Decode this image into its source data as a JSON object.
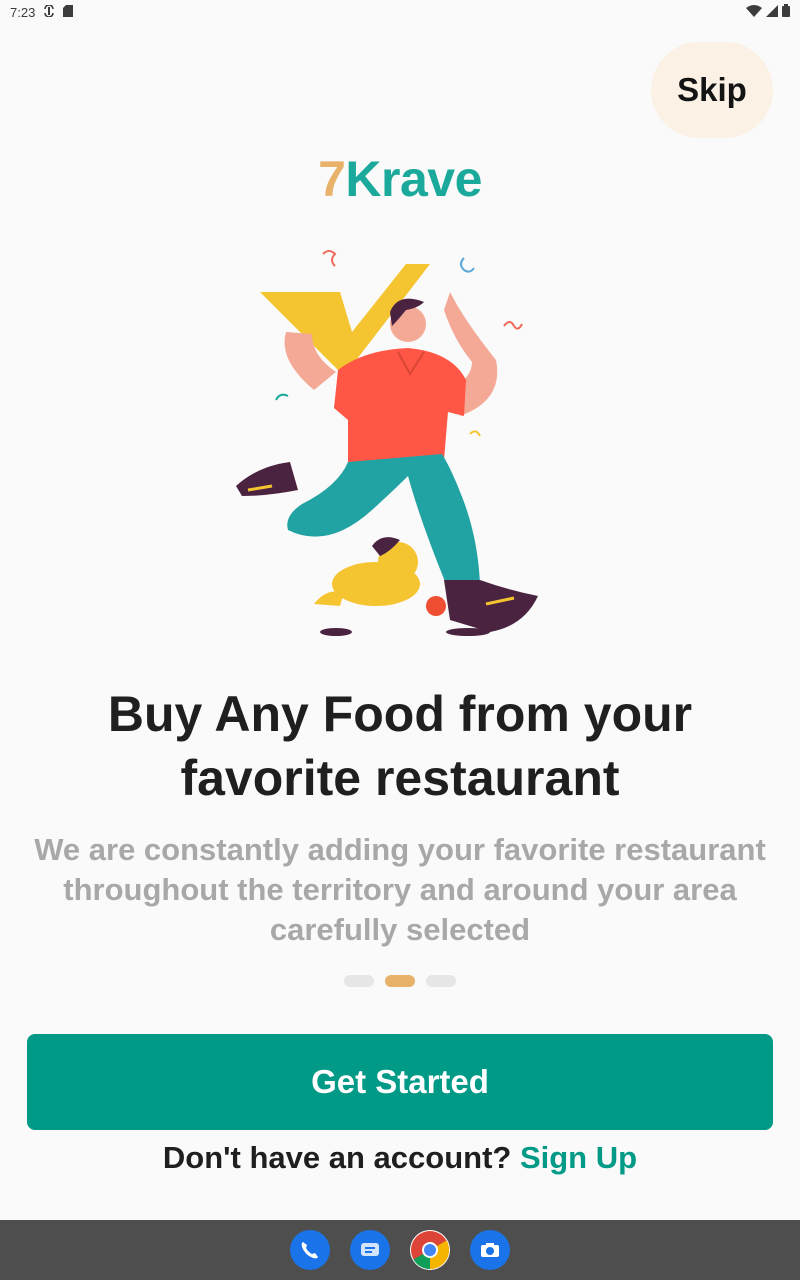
{
  "status_bar": {
    "time": "7:23"
  },
  "skip_label": "Skip",
  "logo": {
    "seven": "7",
    "krave": "Krave"
  },
  "headline": "Buy Any Food from your favorite restaurant",
  "subtext": "We are constantly adding your favorite restaurant throughout the territory and around your area carefully selected",
  "pager": {
    "count": 3,
    "active_index": 1
  },
  "get_started_label": "Get Started",
  "signup": {
    "prompt": "Don't have an account? ",
    "link": "Sign Up"
  },
  "dock": [
    "phone-icon",
    "messages-icon",
    "chrome-icon",
    "camera-icon"
  ],
  "colors": {
    "accent": "#009a87",
    "logo_seven": "#e8b26a",
    "logo_krave": "#1aa99a",
    "skip_bg": "#fbf1e5"
  }
}
